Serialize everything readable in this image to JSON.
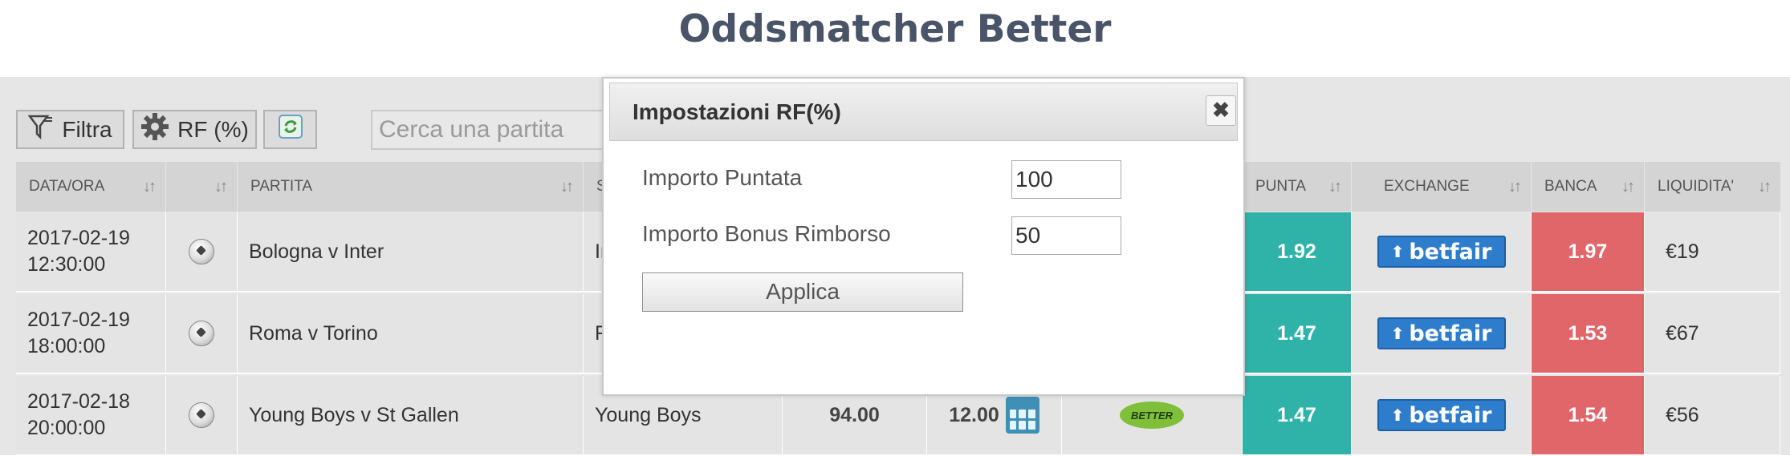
{
  "page": {
    "title": "Oddsmatcher Better"
  },
  "toolbar": {
    "filter_label": "Filtra",
    "rf_label": "RF (%)",
    "search_placeholder": "Cerca una partita"
  },
  "table": {
    "columns": [
      {
        "key": "date",
        "label": "DATA/ORA"
      },
      {
        "key": "sport",
        "label": ""
      },
      {
        "key": "match",
        "label": "PARTITA"
      },
      {
        "key": "selection",
        "label": "S"
      },
      {
        "key": "punta",
        "label": "PUNTA"
      },
      {
        "key": "exchange",
        "label": "EXCHANGE"
      },
      {
        "key": "banca",
        "label": "BANCA"
      },
      {
        "key": "liquidity",
        "label": "LIQUIDITA'"
      }
    ],
    "sort_icon": "↓↑",
    "rows": [
      {
        "date": "2017-02-19",
        "time": "12:30:00",
        "match": "Bologna v Inter",
        "selection": "Ir",
        "rating": "",
        "rf": "",
        "punta": "1.92",
        "exchange": "betfair",
        "banca": "1.97",
        "liquidity": "€19"
      },
      {
        "date": "2017-02-19",
        "time": "18:00:00",
        "match": "Roma v Torino",
        "selection": "R",
        "rating": "",
        "rf": "",
        "punta": "1.47",
        "exchange": "betfair",
        "banca": "1.53",
        "liquidity": "€67"
      },
      {
        "date": "2017-02-18",
        "time": "20:00:00",
        "match": "Young Boys v St Gallen",
        "selection": "Young Boys",
        "rating": "94.00",
        "rf": "12.00",
        "bookmaker": "BETTER",
        "punta": "1.47",
        "exchange": "betfair",
        "banca": "1.54",
        "liquidity": "€56"
      }
    ]
  },
  "modal": {
    "title": "Impostazioni RF(%)",
    "close_icon": "✖",
    "fields": [
      {
        "label": "Importo Puntata",
        "value": "100"
      },
      {
        "label": "Importo Bonus Rimborso",
        "value": "50"
      }
    ],
    "apply_label": "Applica"
  },
  "colors": {
    "title": "#4a5468",
    "punta": "#2fb3a9",
    "banca": "#e0666a",
    "betfair": "#2e7dcc"
  }
}
